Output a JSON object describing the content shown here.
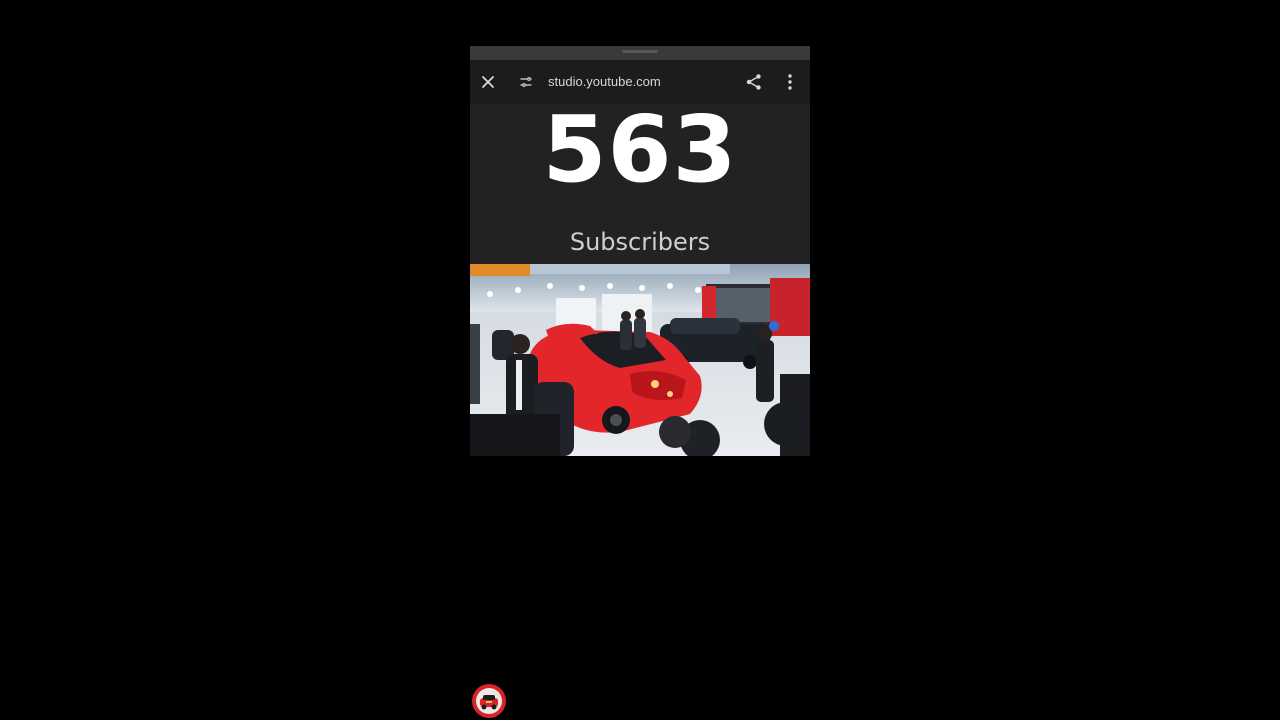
{
  "browser": {
    "url": "studio.youtube.com",
    "icons": {
      "close": "close-icon",
      "site_info": "tune-icon",
      "share": "share-icon",
      "menu": "more-vert-icon"
    }
  },
  "stats": {
    "count": "563",
    "label": "Subscribers"
  },
  "photo": {
    "subject": "red sports car at auto show"
  },
  "overlay": {
    "avatar": "channel-avatar-icon"
  },
  "colors": {
    "page_background": "#000000",
    "card_background": "#222222",
    "toolbar_background": "#1c1c1c",
    "count_text": "#ffffff",
    "label_text": "#cfcfcf",
    "car_accent": "#e3262a"
  }
}
